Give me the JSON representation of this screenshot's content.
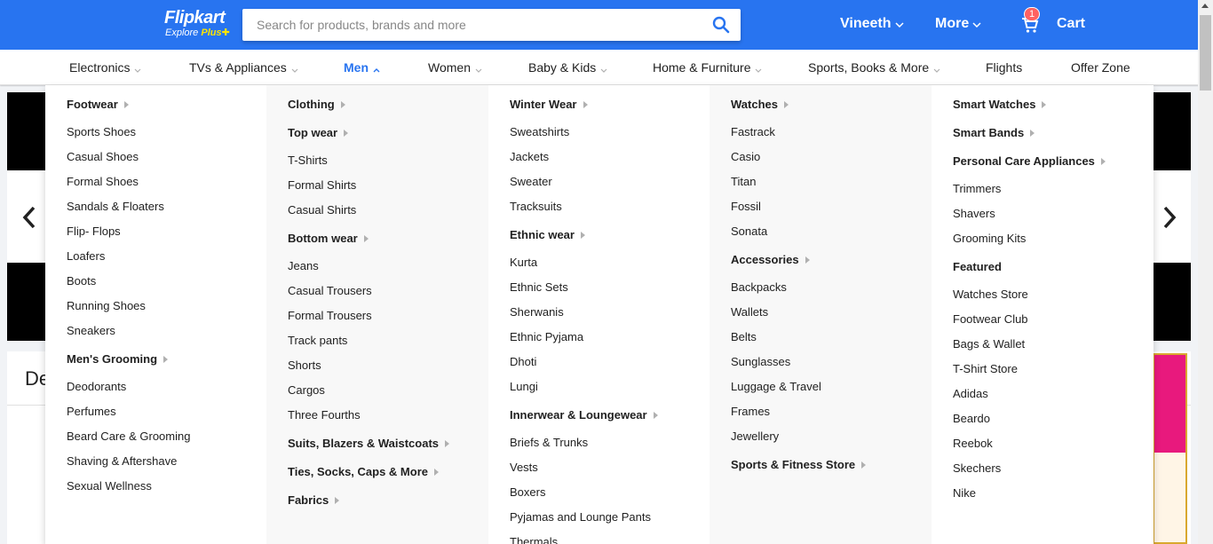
{
  "header": {
    "logo_title": "Flipkart",
    "logo_subtitle": "Explore",
    "logo_plus": "Plus",
    "search_placeholder": "Search for products, brands and more",
    "user_label": "Vineeth",
    "more_label": "More",
    "cart_label": "Cart",
    "cart_count": "1",
    "brand_color": "#2874f0"
  },
  "categories": [
    {
      "label": "Electronics"
    },
    {
      "label": "TVs & Appliances"
    },
    {
      "label": "Men"
    },
    {
      "label": "Women"
    },
    {
      "label": "Baby & Kids"
    },
    {
      "label": "Home & Furniture"
    },
    {
      "label": "Sports, Books & More"
    },
    {
      "label": "Flights"
    },
    {
      "label": "Offer Zone"
    }
  ],
  "page": {
    "deals_title_partial": "De"
  },
  "menu": {
    "columns": [
      {
        "items": [
          {
            "text": "Footwear",
            "type": "head"
          },
          {
            "text": "Sports Shoes",
            "type": "link"
          },
          {
            "text": "Casual Shoes",
            "type": "link"
          },
          {
            "text": "Formal Shoes",
            "type": "link"
          },
          {
            "text": "Sandals & Floaters",
            "type": "link"
          },
          {
            "text": "Flip- Flops",
            "type": "link"
          },
          {
            "text": "Loafers",
            "type": "link"
          },
          {
            "text": "Boots",
            "type": "link"
          },
          {
            "text": "Running Shoes",
            "type": "link"
          },
          {
            "text": "Sneakers",
            "type": "link"
          },
          {
            "text": "Men's Grooming",
            "type": "head"
          },
          {
            "text": "Deodorants",
            "type": "link"
          },
          {
            "text": "Perfumes",
            "type": "link"
          },
          {
            "text": "Beard Care & Grooming",
            "type": "link"
          },
          {
            "text": "Shaving & Aftershave",
            "type": "link"
          },
          {
            "text": "Sexual Wellness",
            "type": "link"
          }
        ]
      },
      {
        "items": [
          {
            "text": "Clothing",
            "type": "head"
          },
          {
            "text": "Top wear",
            "type": "head"
          },
          {
            "text": "T-Shirts",
            "type": "link"
          },
          {
            "text": "Formal Shirts",
            "type": "link"
          },
          {
            "text": "Casual Shirts",
            "type": "link"
          },
          {
            "text": "Bottom wear",
            "type": "head"
          },
          {
            "text": "Jeans",
            "type": "link"
          },
          {
            "text": "Casual Trousers",
            "type": "link"
          },
          {
            "text": "Formal Trousers",
            "type": "link"
          },
          {
            "text": "Track pants",
            "type": "link"
          },
          {
            "text": "Shorts",
            "type": "link"
          },
          {
            "text": "Cargos",
            "type": "link"
          },
          {
            "text": "Three Fourths",
            "type": "link"
          },
          {
            "text": "Suits, Blazers & Waistcoats",
            "type": "head"
          },
          {
            "text": "Ties, Socks, Caps & More",
            "type": "head"
          },
          {
            "text": "Fabrics",
            "type": "head"
          }
        ]
      },
      {
        "items": [
          {
            "text": "Winter Wear",
            "type": "head"
          },
          {
            "text": "Sweatshirts",
            "type": "link"
          },
          {
            "text": "Jackets",
            "type": "link"
          },
          {
            "text": "Sweater",
            "type": "link"
          },
          {
            "text": "Tracksuits",
            "type": "link"
          },
          {
            "text": "Ethnic wear",
            "type": "head"
          },
          {
            "text": "Kurta",
            "type": "link"
          },
          {
            "text": "Ethnic Sets",
            "type": "link"
          },
          {
            "text": "Sherwanis",
            "type": "link"
          },
          {
            "text": "Ethnic Pyjama",
            "type": "link"
          },
          {
            "text": "Dhoti",
            "type": "link"
          },
          {
            "text": "Lungi",
            "type": "link"
          },
          {
            "text": "Innerwear & Loungewear",
            "type": "head"
          },
          {
            "text": "Briefs & Trunks",
            "type": "link"
          },
          {
            "text": "Vests",
            "type": "link"
          },
          {
            "text": "Boxers",
            "type": "link"
          },
          {
            "text": "Pyjamas and Lounge Pants",
            "type": "link"
          },
          {
            "text": "Thermals",
            "type": "link"
          }
        ]
      },
      {
        "items": [
          {
            "text": "Watches",
            "type": "head"
          },
          {
            "text": "Fastrack",
            "type": "link"
          },
          {
            "text": "Casio",
            "type": "link"
          },
          {
            "text": "Titan",
            "type": "link"
          },
          {
            "text": "Fossil",
            "type": "link"
          },
          {
            "text": "Sonata",
            "type": "link"
          },
          {
            "text": "Accessories",
            "type": "head"
          },
          {
            "text": "Backpacks",
            "type": "link"
          },
          {
            "text": "Wallets",
            "type": "link"
          },
          {
            "text": "Belts",
            "type": "link"
          },
          {
            "text": "Sunglasses",
            "type": "link"
          },
          {
            "text": "Luggage & Travel",
            "type": "link"
          },
          {
            "text": "Frames",
            "type": "link"
          },
          {
            "text": "Jewellery",
            "type": "link"
          },
          {
            "text": "Sports & Fitness Store",
            "type": "head"
          }
        ]
      },
      {
        "items": [
          {
            "text": "Smart Watches",
            "type": "head"
          },
          {
            "text": "Smart Bands",
            "type": "head"
          },
          {
            "text": "Personal Care Appliances",
            "type": "head"
          },
          {
            "text": "Trimmers",
            "type": "link"
          },
          {
            "text": "Shavers",
            "type": "link"
          },
          {
            "text": "Grooming Kits",
            "type": "link"
          },
          {
            "text": "Featured",
            "type": "head-plain"
          },
          {
            "text": "Watches Store",
            "type": "link"
          },
          {
            "text": "Footwear Club",
            "type": "link"
          },
          {
            "text": "Bags & Wallet",
            "type": "link"
          },
          {
            "text": "T-Shirt Store",
            "type": "link"
          },
          {
            "text": "Adidas",
            "type": "link"
          },
          {
            "text": "Beardo",
            "type": "link"
          },
          {
            "text": "Reebok",
            "type": "link"
          },
          {
            "text": "Skechers",
            "type": "link"
          },
          {
            "text": "Nike",
            "type": "link"
          }
        ]
      }
    ]
  }
}
